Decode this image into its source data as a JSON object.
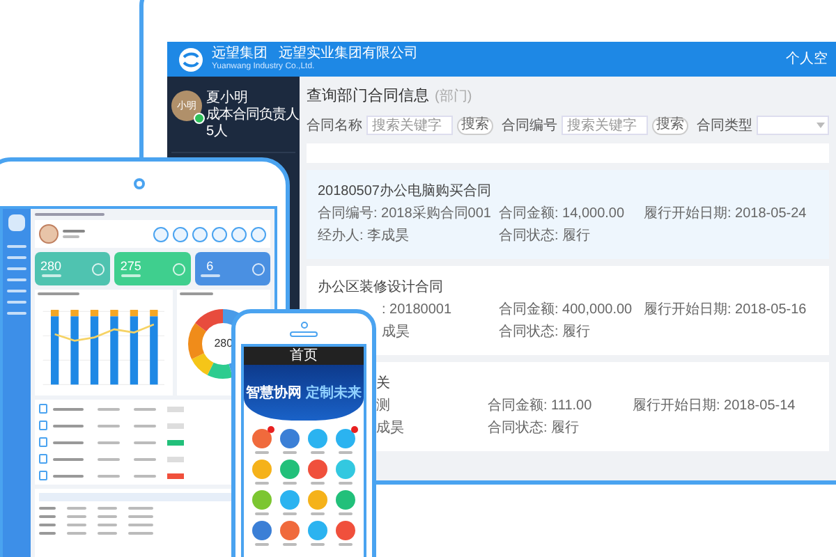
{
  "monitor": {
    "header": {
      "brand": "远望集团",
      "company": "远望实业集团有限公司",
      "company_en": "Yuanwang Industry Co.,Ltd.",
      "nav_link": "个人空"
    },
    "user": {
      "avatar_text": "小明",
      "name": "夏小明",
      "role": "成本合同负责人",
      "count": "5人",
      "online": true
    },
    "page_title": "查询部门合同信息",
    "page_note": "(部门)",
    "filters": [
      {
        "kind": "search",
        "label": "合同名称",
        "placeholder": "搜索关键字",
        "button": "搜索"
      },
      {
        "kind": "search",
        "label": "合同编号",
        "placeholder": "搜索关键字",
        "button": "搜索"
      },
      {
        "kind": "select",
        "label": "合同类型"
      }
    ],
    "contracts": [
      {
        "title": "20180507办公电脑购买合同",
        "selected": true,
        "fields": [
          "合同编号: 2018采购合同001",
          "合同金额: 14,000.00",
          "履行开始日期: 2018-05-24",
          "经办人: 李成昊",
          "合同状态: 履行"
        ]
      },
      {
        "title": "办公区装修设计合同",
        "selected": false,
        "fields": [
          ": 20180001",
          "合同金额: 400,000.00",
          "履行开始日期: 2018-05-16",
          "成昊",
          "合同状态: 履行"
        ]
      },
      {
        "title": "关",
        "selected": false,
        "fields": [
          "测",
          "合同金额: 111.00",
          "履行开始日期: 2018-05-14",
          "成昊",
          "合同状态: 履行"
        ]
      }
    ]
  },
  "tablet": {
    "stats": [
      {
        "value": "280",
        "color": "#4fc3b0"
      },
      {
        "value": "275",
        "color": "#3fcf8e"
      },
      {
        "value": "6",
        "color": "#4a90e2"
      }
    ],
    "donut_center": "280"
  },
  "phone": {
    "title": "首页",
    "banner": [
      "智慧协网",
      "定制未来"
    ],
    "apps": [
      {
        "color": "#f06a3c",
        "badge": true
      },
      {
        "color": "#3b7fd6",
        "badge": false
      },
      {
        "color": "#2bb3f0",
        "badge": false
      },
      {
        "color": "#2bb3f0",
        "badge": true
      },
      {
        "color": "#f5b21a",
        "badge": false
      },
      {
        "color": "#22c07a",
        "badge": false
      },
      {
        "color": "#f0503c",
        "badge": false
      },
      {
        "color": "#33c8e0",
        "badge": false
      },
      {
        "color": "#7cc631",
        "badge": false
      },
      {
        "color": "#2bb3f0",
        "badge": false
      },
      {
        "color": "#f5b21a",
        "badge": false
      },
      {
        "color": "#22c07a",
        "badge": false
      },
      {
        "color": "#3b7fd6",
        "badge": false
      },
      {
        "color": "#f06a3c",
        "badge": false
      },
      {
        "color": "#2bb3f0",
        "badge": false
      },
      {
        "color": "#f0503c",
        "badge": false
      }
    ]
  }
}
